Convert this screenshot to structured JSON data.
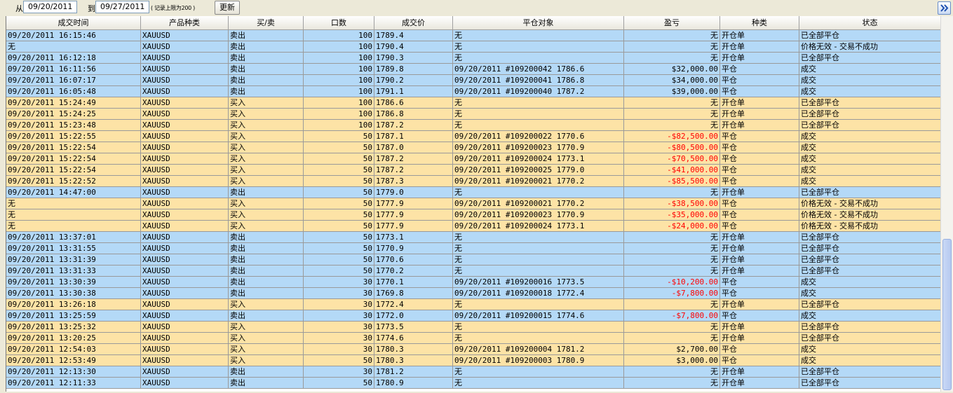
{
  "toolbar": {
    "from_label": "从",
    "from_value": "09/20/2011",
    "to_label": "到",
    "to_value": "09/27/2011",
    "limit_note": "( 记录上限为200 )",
    "refresh_label": "更新",
    "nav_icon": "double-chevron-right-icon"
  },
  "colors": {
    "sell_row": "#b4d9f7",
    "buy_row": "#fde3a6",
    "negative": "#ff0000"
  },
  "table": {
    "columns": [
      "成交时间",
      "产品种类",
      "买/卖",
      "口数",
      "成交价",
      "平仓对象",
      "盈亏",
      "种类",
      "状态"
    ],
    "rows": [
      [
        "09/20/2011 16:15:46",
        "XAUUSD",
        "卖出",
        "100",
        "1789.4",
        "无",
        "无",
        "开仓单",
        "已全部平仓"
      ],
      [
        "无",
        "XAUUSD",
        "卖出",
        "100",
        "1790.4",
        "无",
        "无",
        "开仓单",
        "价格无效 - 交易不成功"
      ],
      [
        "09/20/2011 16:12:18",
        "XAUUSD",
        "卖出",
        "100",
        "1790.3",
        "无",
        "无",
        "开仓单",
        "已全部平仓"
      ],
      [
        "09/20/2011 16:11:56",
        "XAUUSD",
        "卖出",
        "100",
        "1789.8",
        "09/20/2011 #109200042 1786.6",
        "$32,000.00",
        "平仓",
        "成交"
      ],
      [
        "09/20/2011 16:07:17",
        "XAUUSD",
        "卖出",
        "100",
        "1790.2",
        "09/20/2011 #109200041 1786.8",
        "$34,000.00",
        "平仓",
        "成交"
      ],
      [
        "09/20/2011 16:05:48",
        "XAUUSD",
        "卖出",
        "100",
        "1791.1",
        "09/20/2011 #109200040 1787.2",
        "$39,000.00",
        "平仓",
        "成交"
      ],
      [
        "09/20/2011 15:24:49",
        "XAUUSD",
        "买入",
        "100",
        "1786.6",
        "无",
        "无",
        "开仓单",
        "已全部平仓"
      ],
      [
        "09/20/2011 15:24:25",
        "XAUUSD",
        "买入",
        "100",
        "1786.8",
        "无",
        "无",
        "开仓单",
        "已全部平仓"
      ],
      [
        "09/20/2011 15:23:48",
        "XAUUSD",
        "买入",
        "100",
        "1787.2",
        "无",
        "无",
        "开仓单",
        "已全部平仓"
      ],
      [
        "09/20/2011 15:22:55",
        "XAUUSD",
        "买入",
        "50",
        "1787.1",
        "09/20/2011 #109200022 1770.6",
        "-$82,500.00",
        "平仓",
        "成交"
      ],
      [
        "09/20/2011 15:22:54",
        "XAUUSD",
        "买入",
        "50",
        "1787.0",
        "09/20/2011 #109200023 1770.9",
        "-$80,500.00",
        "平仓",
        "成交"
      ],
      [
        "09/20/2011 15:22:54",
        "XAUUSD",
        "买入",
        "50",
        "1787.2",
        "09/20/2011 #109200024 1773.1",
        "-$70,500.00",
        "平仓",
        "成交"
      ],
      [
        "09/20/2011 15:22:54",
        "XAUUSD",
        "买入",
        "50",
        "1787.2",
        "09/20/2011 #109200025 1779.0",
        "-$41,000.00",
        "平仓",
        "成交"
      ],
      [
        "09/20/2011 15:22:52",
        "XAUUSD",
        "买入",
        "50",
        "1787.3",
        "09/20/2011 #109200021 1770.2",
        "-$85,500.00",
        "平仓",
        "成交"
      ],
      [
        "09/20/2011 14:47:00",
        "XAUUSD",
        "卖出",
        "50",
        "1779.0",
        "无",
        "无",
        "开仓单",
        "已全部平仓"
      ],
      [
        "无",
        "XAUUSD",
        "买入",
        "50",
        "1777.9",
        "09/20/2011 #109200021 1770.2",
        "-$38,500.00",
        "平仓",
        "价格无效 - 交易不成功"
      ],
      [
        "无",
        "XAUUSD",
        "买入",
        "50",
        "1777.9",
        "09/20/2011 #109200023 1770.9",
        "-$35,000.00",
        "平仓",
        "价格无效 - 交易不成功"
      ],
      [
        "无",
        "XAUUSD",
        "买入",
        "50",
        "1777.9",
        "09/20/2011 #109200024 1773.1",
        "-$24,000.00",
        "平仓",
        "价格无效 - 交易不成功"
      ],
      [
        "09/20/2011 13:37:01",
        "XAUUSD",
        "卖出",
        "50",
        "1773.1",
        "无",
        "无",
        "开仓单",
        "已全部平仓"
      ],
      [
        "09/20/2011 13:31:55",
        "XAUUSD",
        "卖出",
        "50",
        "1770.9",
        "无",
        "无",
        "开仓单",
        "已全部平仓"
      ],
      [
        "09/20/2011 13:31:39",
        "XAUUSD",
        "卖出",
        "50",
        "1770.6",
        "无",
        "无",
        "开仓单",
        "已全部平仓"
      ],
      [
        "09/20/2011 13:31:33",
        "XAUUSD",
        "卖出",
        "50",
        "1770.2",
        "无",
        "无",
        "开仓单",
        "已全部平仓"
      ],
      [
        "09/20/2011 13:30:39",
        "XAUUSD",
        "卖出",
        "30",
        "1770.1",
        "09/20/2011 #109200016 1773.5",
        "-$10,200.00",
        "平仓",
        "成交"
      ],
      [
        "09/20/2011 13:30:38",
        "XAUUSD",
        "卖出",
        "30",
        "1769.8",
        "09/20/2011 #109200018 1772.4",
        "-$7,800.00",
        "平仓",
        "成交"
      ],
      [
        "09/20/2011 13:26:18",
        "XAUUSD",
        "买入",
        "30",
        "1772.4",
        "无",
        "无",
        "开仓单",
        "已全部平仓"
      ],
      [
        "09/20/2011 13:25:59",
        "XAUUSD",
        "卖出",
        "30",
        "1772.0",
        "09/20/2011 #109200015 1774.6",
        "-$7,800.00",
        "平仓",
        "成交"
      ],
      [
        "09/20/2011 13:25:32",
        "XAUUSD",
        "买入",
        "30",
        "1773.5",
        "无",
        "无",
        "开仓单",
        "已全部平仓"
      ],
      [
        "09/20/2011 13:20:25",
        "XAUUSD",
        "买入",
        "30",
        "1774.6",
        "无",
        "无",
        "开仓单",
        "已全部平仓"
      ],
      [
        "09/20/2011 12:54:03",
        "XAUUSD",
        "买入",
        "30",
        "1780.3",
        "09/20/2011 #109200004 1781.2",
        "$2,700.00",
        "平仓",
        "成交"
      ],
      [
        "09/20/2011 12:53:49",
        "XAUUSD",
        "买入",
        "50",
        "1780.3",
        "09/20/2011 #109200003 1780.9",
        "$3,000.00",
        "平仓",
        "成交"
      ],
      [
        "09/20/2011 12:13:30",
        "XAUUSD",
        "卖出",
        "30",
        "1781.2",
        "无",
        "无",
        "开仓单",
        "已全部平仓"
      ],
      [
        "09/20/2011 12:11:33",
        "XAUUSD",
        "卖出",
        "50",
        "1780.9",
        "无",
        "无",
        "开仓单",
        "已全部平仓"
      ]
    ]
  }
}
